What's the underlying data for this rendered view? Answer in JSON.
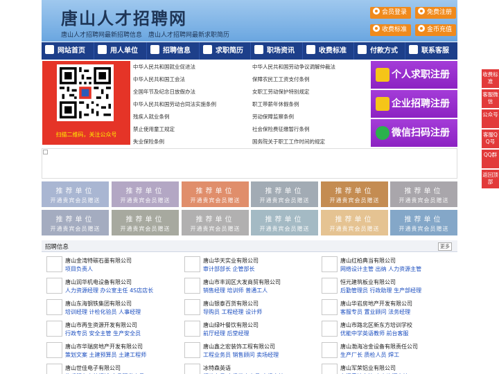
{
  "header": {
    "title": "唐山人才招聘网",
    "subtitle": "唐山人才招聘网最新招聘信息　唐山人才招聘网最新求职简历",
    "buttons": [
      "会员登录",
      "免费注册",
      "收费标准",
      "金币充值"
    ]
  },
  "nav": {
    "items": [
      "网站首页",
      "用人单位",
      "招聘信息",
      "求职简历",
      "职场资讯",
      "收费标准",
      "付款方式",
      "联系客服"
    ]
  },
  "qr": {
    "caption": "扫描二维码，关注公众号"
  },
  "laws": [
    "中华人民共和国就业促进法",
    "中华人民共和国劳动争议调解仲裁法",
    "中华人民共和国工会法",
    "保障农民工工资支付条例",
    "全国年节及纪念日放假办法",
    "女职工劳动保护特别规定",
    "中华人民共和国劳动合同法实施条例",
    "职工带薪年休假条例",
    "残疾人就业条例",
    "劳动保障监察条例",
    "禁止使用童工规定",
    "社会保险费征缴暂行条例",
    "失业保险条例",
    "国务院关于职工工作时间的规定"
  ],
  "register": [
    "个人求职注册",
    "企业招聘注册",
    "微信扫码注册"
  ],
  "float_bar": [
    "收费标准",
    "客服微信",
    "公众号",
    "客服QQ号",
    "QQ群",
    "返回顶部"
  ],
  "recommend": {
    "line1": "推荐单位",
    "line2": "开通贵宾会员赠送",
    "colors": [
      "#a9b6d2",
      "#b3a7c4",
      "#e08e6b",
      "#a2abb4",
      "#c48c52",
      "#a9a6ab",
      "#a4acc0",
      "#a7a99f",
      "#b1b0b0",
      "#a4bac4",
      "#e5c392",
      "#84a7c8"
    ]
  },
  "jobs": {
    "title": "招聘信息",
    "more": "更多",
    "items": [
      {
        "company": "唐山金湾特碳石墨有限公司",
        "positions": "项目负责人"
      },
      {
        "company": "唐山华天实业有限公司",
        "positions": "审计部部长 企管部长"
      },
      {
        "company": "唐山红柏典当有限公司",
        "positions": "网络设计主管 出纳 人力资源主管"
      },
      {
        "company": "唐山润华机电设备有限公司",
        "positions": "人力资源经理 办公室主任 4S店店长"
      },
      {
        "company": "唐山市丰润区大发商贸有限公司",
        "positions": "销售经理 培训师 普通工人"
      },
      {
        "company": "恒元建筑板业有限公司",
        "positions": "后勤管理员 行政助理 生产部经理"
      },
      {
        "company": "唐山东海钢铁集团有限公司",
        "positions": "培训经理 计检化验员 人事经理"
      },
      {
        "company": "唐山银泰百货有限公司",
        "positions": "导购员 工程经理 设计师"
      },
      {
        "company": "唐山华岩房地产开发有限公司",
        "positions": "客服专员 置业顾问 法务经理"
      },
      {
        "company": "唐山市再生资源开发有限公司",
        "positions": "行政专员 安全主管 生产安全员"
      },
      {
        "company": "唐山绿叶餐饮有限公司",
        "positions": "前厅经理 后堂经理"
      },
      {
        "company": "唐山市路北区新东方培训学校",
        "positions": "优能中学英语教师 前台客服"
      },
      {
        "company": "唐山市华瑞房地产开发有限公司",
        "positions": "策划文案 土建预算员 土建工程师"
      },
      {
        "company": "唐山鑫之宏装饰工程有限公司",
        "positions": "工程业务员 销售顾问 卖场经理"
      },
      {
        "company": "唐山渤海冶金设备有限责任公司",
        "positions": "生产厂长 质检人员 焊工"
      },
      {
        "company": "唐山世佳电子有限公司",
        "positions": "售后服务安装调试 产品研发人员"
      },
      {
        "company": "冰特森英语",
        "positions": "行政专员 市场推广专员 市场主管"
      },
      {
        "company": "唐山军荣铝业有限公司",
        "positions": "车间质检主管 人力资源主管"
      }
    ]
  }
}
